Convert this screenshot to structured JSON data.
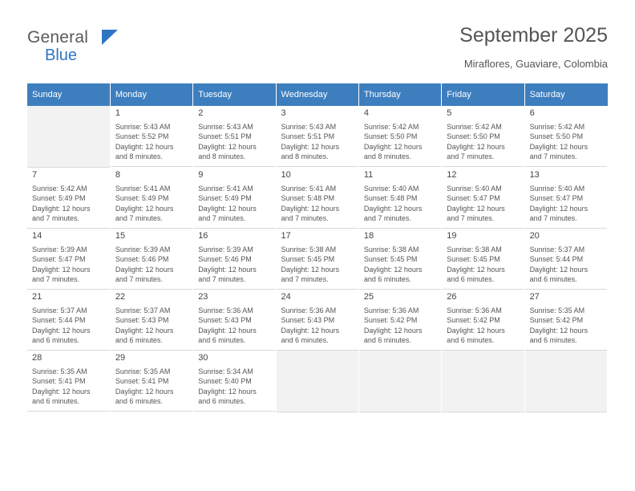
{
  "brand": {
    "name_top": "General",
    "name_bottom": "Blue",
    "accent_color": "#2e75c4"
  },
  "header": {
    "title": "September 2025",
    "location": "Miraflores, Guaviare, Colombia"
  },
  "calendar": {
    "header_bg": "#3d7ebf",
    "weekdays": [
      "Sunday",
      "Monday",
      "Tuesday",
      "Wednesday",
      "Thursday",
      "Friday",
      "Saturday"
    ],
    "weeks": [
      [
        {
          "day": "",
          "lines": []
        },
        {
          "day": "1",
          "lines": [
            "Sunrise: 5:43 AM",
            "Sunset: 5:52 PM",
            "Daylight: 12 hours",
            "and 8 minutes."
          ]
        },
        {
          "day": "2",
          "lines": [
            "Sunrise: 5:43 AM",
            "Sunset: 5:51 PM",
            "Daylight: 12 hours",
            "and 8 minutes."
          ]
        },
        {
          "day": "3",
          "lines": [
            "Sunrise: 5:43 AM",
            "Sunset: 5:51 PM",
            "Daylight: 12 hours",
            "and 8 minutes."
          ]
        },
        {
          "day": "4",
          "lines": [
            "Sunrise: 5:42 AM",
            "Sunset: 5:50 PM",
            "Daylight: 12 hours",
            "and 8 minutes."
          ]
        },
        {
          "day": "5",
          "lines": [
            "Sunrise: 5:42 AM",
            "Sunset: 5:50 PM",
            "Daylight: 12 hours",
            "and 7 minutes."
          ]
        },
        {
          "day": "6",
          "lines": [
            "Sunrise: 5:42 AM",
            "Sunset: 5:50 PM",
            "Daylight: 12 hours",
            "and 7 minutes."
          ]
        }
      ],
      [
        {
          "day": "7",
          "lines": [
            "Sunrise: 5:42 AM",
            "Sunset: 5:49 PM",
            "Daylight: 12 hours",
            "and 7 minutes."
          ]
        },
        {
          "day": "8",
          "lines": [
            "Sunrise: 5:41 AM",
            "Sunset: 5:49 PM",
            "Daylight: 12 hours",
            "and 7 minutes."
          ]
        },
        {
          "day": "9",
          "lines": [
            "Sunrise: 5:41 AM",
            "Sunset: 5:49 PM",
            "Daylight: 12 hours",
            "and 7 minutes."
          ]
        },
        {
          "day": "10",
          "lines": [
            "Sunrise: 5:41 AM",
            "Sunset: 5:48 PM",
            "Daylight: 12 hours",
            "and 7 minutes."
          ]
        },
        {
          "day": "11",
          "lines": [
            "Sunrise: 5:40 AM",
            "Sunset: 5:48 PM",
            "Daylight: 12 hours",
            "and 7 minutes."
          ]
        },
        {
          "day": "12",
          "lines": [
            "Sunrise: 5:40 AM",
            "Sunset: 5:47 PM",
            "Daylight: 12 hours",
            "and 7 minutes."
          ]
        },
        {
          "day": "13",
          "lines": [
            "Sunrise: 5:40 AM",
            "Sunset: 5:47 PM",
            "Daylight: 12 hours",
            "and 7 minutes."
          ]
        }
      ],
      [
        {
          "day": "14",
          "lines": [
            "Sunrise: 5:39 AM",
            "Sunset: 5:47 PM",
            "Daylight: 12 hours",
            "and 7 minutes."
          ]
        },
        {
          "day": "15",
          "lines": [
            "Sunrise: 5:39 AM",
            "Sunset: 5:46 PM",
            "Daylight: 12 hours",
            "and 7 minutes."
          ]
        },
        {
          "day": "16",
          "lines": [
            "Sunrise: 5:39 AM",
            "Sunset: 5:46 PM",
            "Daylight: 12 hours",
            "and 7 minutes."
          ]
        },
        {
          "day": "17",
          "lines": [
            "Sunrise: 5:38 AM",
            "Sunset: 5:45 PM",
            "Daylight: 12 hours",
            "and 7 minutes."
          ]
        },
        {
          "day": "18",
          "lines": [
            "Sunrise: 5:38 AM",
            "Sunset: 5:45 PM",
            "Daylight: 12 hours",
            "and 6 minutes."
          ]
        },
        {
          "day": "19",
          "lines": [
            "Sunrise: 5:38 AM",
            "Sunset: 5:45 PM",
            "Daylight: 12 hours",
            "and 6 minutes."
          ]
        },
        {
          "day": "20",
          "lines": [
            "Sunrise: 5:37 AM",
            "Sunset: 5:44 PM",
            "Daylight: 12 hours",
            "and 6 minutes."
          ]
        }
      ],
      [
        {
          "day": "21",
          "lines": [
            "Sunrise: 5:37 AM",
            "Sunset: 5:44 PM",
            "Daylight: 12 hours",
            "and 6 minutes."
          ]
        },
        {
          "day": "22",
          "lines": [
            "Sunrise: 5:37 AM",
            "Sunset: 5:43 PM",
            "Daylight: 12 hours",
            "and 6 minutes."
          ]
        },
        {
          "day": "23",
          "lines": [
            "Sunrise: 5:36 AM",
            "Sunset: 5:43 PM",
            "Daylight: 12 hours",
            "and 6 minutes."
          ]
        },
        {
          "day": "24",
          "lines": [
            "Sunrise: 5:36 AM",
            "Sunset: 5:43 PM",
            "Daylight: 12 hours",
            "and 6 minutes."
          ]
        },
        {
          "day": "25",
          "lines": [
            "Sunrise: 5:36 AM",
            "Sunset: 5:42 PM",
            "Daylight: 12 hours",
            "and 6 minutes."
          ]
        },
        {
          "day": "26",
          "lines": [
            "Sunrise: 5:36 AM",
            "Sunset: 5:42 PM",
            "Daylight: 12 hours",
            "and 6 minutes."
          ]
        },
        {
          "day": "27",
          "lines": [
            "Sunrise: 5:35 AM",
            "Sunset: 5:42 PM",
            "Daylight: 12 hours",
            "and 6 minutes."
          ]
        }
      ],
      [
        {
          "day": "28",
          "lines": [
            "Sunrise: 5:35 AM",
            "Sunset: 5:41 PM",
            "Daylight: 12 hours",
            "and 6 minutes."
          ]
        },
        {
          "day": "29",
          "lines": [
            "Sunrise: 5:35 AM",
            "Sunset: 5:41 PM",
            "Daylight: 12 hours",
            "and 6 minutes."
          ]
        },
        {
          "day": "30",
          "lines": [
            "Sunrise: 5:34 AM",
            "Sunset: 5:40 PM",
            "Daylight: 12 hours",
            "and 6 minutes."
          ]
        },
        {
          "day": "",
          "lines": []
        },
        {
          "day": "",
          "lines": []
        },
        {
          "day": "",
          "lines": []
        },
        {
          "day": "",
          "lines": []
        }
      ]
    ]
  }
}
